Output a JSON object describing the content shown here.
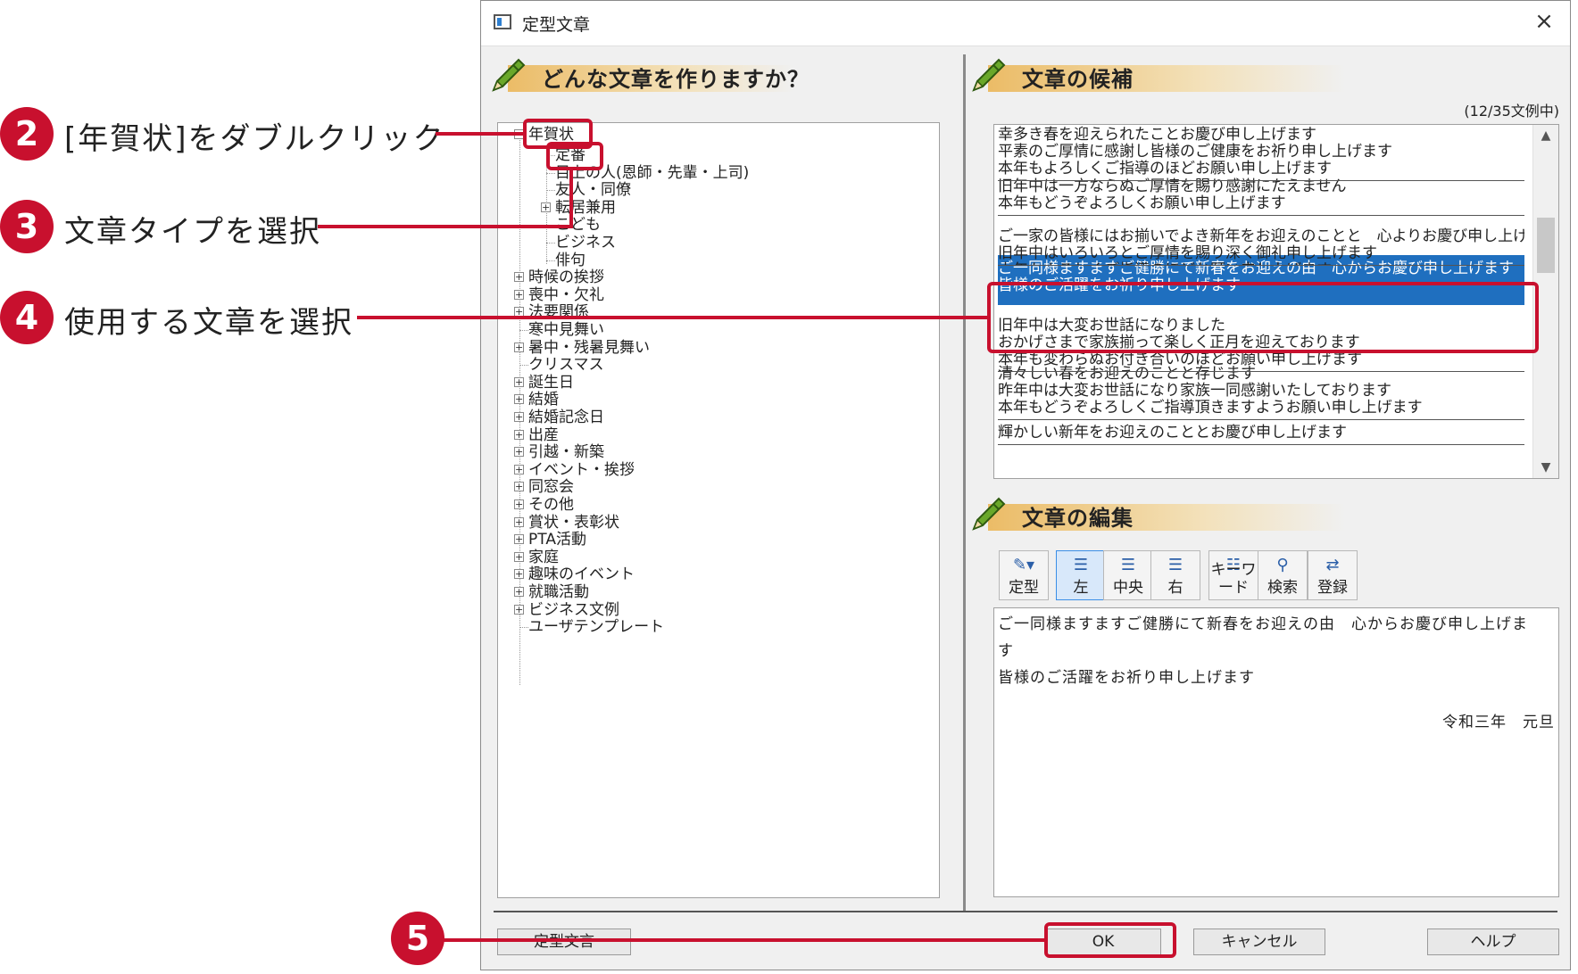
{
  "window": {
    "title": "定型文章",
    "close": "×"
  },
  "left_panel": {
    "heading": "どんな文章を作りますか？",
    "tree": [
      {
        "label": "年賀状",
        "expander": "−",
        "level": 0
      },
      {
        "label": "定番",
        "expander": "",
        "level": 1
      },
      {
        "label": "目上の人(恩師・先輩・上司)",
        "expander": "",
        "level": 1
      },
      {
        "label": "友人・同僚",
        "expander": "",
        "level": 1
      },
      {
        "label": "転居兼用",
        "expander": "+",
        "level": 1
      },
      {
        "label": "こども",
        "expander": "",
        "level": 1
      },
      {
        "label": "ビジネス",
        "expander": "",
        "level": 1
      },
      {
        "label": "俳句",
        "expander": "",
        "level": 1
      },
      {
        "label": "時候の挨拶",
        "expander": "+",
        "level": 0
      },
      {
        "label": "喪中・欠礼",
        "expander": "+",
        "level": 0
      },
      {
        "label": "法要関係",
        "expander": "+",
        "level": 0
      },
      {
        "label": "寒中見舞い",
        "expander": "",
        "level": 0
      },
      {
        "label": "暑中・残暑見舞い",
        "expander": "+",
        "level": 0
      },
      {
        "label": "クリスマス",
        "expander": "",
        "level": 0
      },
      {
        "label": "誕生日",
        "expander": "+",
        "level": 0
      },
      {
        "label": "結婚",
        "expander": "+",
        "level": 0
      },
      {
        "label": "結婚記念日",
        "expander": "+",
        "level": 0
      },
      {
        "label": "出産",
        "expander": "+",
        "level": 0
      },
      {
        "label": "引越・新築",
        "expander": "+",
        "level": 0
      },
      {
        "label": "イベント・挨拶",
        "expander": "+",
        "level": 0
      },
      {
        "label": "同窓会",
        "expander": "+",
        "level": 0
      },
      {
        "label": "その他",
        "expander": "+",
        "level": 0
      },
      {
        "label": "賞状・表彰状",
        "expander": "+",
        "level": 0
      },
      {
        "label": "PTA活動",
        "expander": "+",
        "level": 0
      },
      {
        "label": "家庭",
        "expander": "+",
        "level": 0
      },
      {
        "label": "趣味のイベント",
        "expander": "+",
        "level": 0
      },
      {
        "label": "就職活動",
        "expander": "+",
        "level": 0
      },
      {
        "label": "ビジネス文例",
        "expander": "+",
        "level": 0
      },
      {
        "label": "ユーザテンプレート",
        "expander": "",
        "level": 0
      }
    ]
  },
  "right_panel": {
    "candidates_heading": "文章の候補",
    "count": "(12/35文例中)",
    "candidates": [
      [
        "幸多き春を迎えられたことお慶び申し上げます",
        "平素のご厚情に感謝し皆様のご健康をお祈り申し上げます",
        "本年もよろしくご指導のほどお願い申し上げます"
      ],
      [
        "旧年中は一方ならぬご厚情を賜り感謝にたえません",
        "本年もどうぞよろしくお願い申し上げます"
      ],
      [
        "ご一家の皆様にはお揃いでよき新年をお迎えのことと　心よりお慶び申し上げます",
        "旧年中はいろいろとご厚情を賜り深く御礼申し上げます",
        "本年もよろしくご指導のほどお願い申し上げます"
      ],
      [
        "ご一同様ますますご健勝にて新春をお迎えの由　心からお慶び申し上げます",
        "皆様のご活躍をお祈り申し上げます"
      ],
      [
        "旧年中は大変お世話になりました",
        "おかげさまで家族揃って楽しく正月を迎えております",
        "本年も変わらぬお付き合いのほどお願い申し上げます"
      ],
      [
        "清々しい春をお迎えのことと存じます",
        "昨年中は大変お世話になり家族一同感謝いたしております",
        "本年もどうぞよろしくご指導頂きますようお願い申し上げます"
      ],
      [
        "輝かしい新年をお迎えのこととお慶び申し上げます"
      ]
    ],
    "selected_index": 3,
    "edit_heading": "文章の編集",
    "toolbar": [
      {
        "label": "定型",
        "icon": "template-icon"
      },
      {
        "label": "左",
        "icon": "align-left-icon"
      },
      {
        "label": "中央",
        "icon": "align-center-icon"
      },
      {
        "label": "右",
        "icon": "align-right-icon"
      },
      {
        "label": "キーワード",
        "icon": "keyword-icon"
      },
      {
        "label": "検索",
        "icon": "search-icon"
      },
      {
        "label": "登録",
        "icon": "register-icon"
      }
    ],
    "editor_lines": [
      "ご一同様ますますご健勝にて新春をお迎えの由　心からお慶び申し上げま",
      "す",
      "皆様のご活躍をお祈り申し上げます",
      "令和三年　元旦"
    ]
  },
  "buttons": {
    "teikei_hogo": "定型文言",
    "ok": "OK",
    "cancel": "キャンセル",
    "help": "ヘルプ"
  },
  "annotations": [
    {
      "num": "2",
      "text": "[年賀状]をダブルクリック"
    },
    {
      "num": "3",
      "text": "文章タイプを選択"
    },
    {
      "num": "4",
      "text": "使用する文章を選択"
    },
    {
      "num": "5",
      "text": ""
    }
  ],
  "colors": {
    "accent_red": "#c8102e",
    "selection_blue": "#1f6fbf"
  }
}
